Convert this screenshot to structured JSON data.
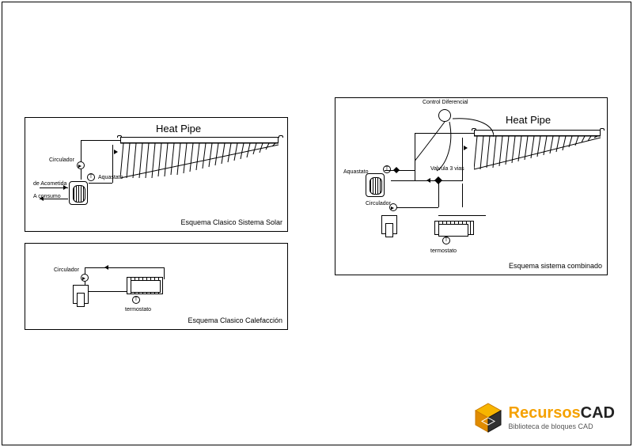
{
  "panel1": {
    "title": "Esquema Clasico Sistema Solar",
    "heatpipe": "Heat Pipe",
    "labels": {
      "circulador": "Circulador",
      "aquastato": "Aquastato",
      "deAcometida": "de Acometida",
      "aConsumo": "A consumo"
    }
  },
  "panel2": {
    "title": "Esquema Clasico Calefacción",
    "labels": {
      "circulador": "Circulador",
      "termostato": "termostato"
    }
  },
  "panel3": {
    "title": "Esquema sistema combinado",
    "heatpipe": "Heat Pipe",
    "labels": {
      "controlDiferencial": "Control Diferencial",
      "valvula3vias": "Valvula 3 vias",
      "aquastato": "Aquastato",
      "circulador": "Circulador",
      "termostato": "termostato"
    }
  },
  "sensorT": "T",
  "logo": {
    "brandYellow": "Recursos",
    "brandBlack": "CAD",
    "tagline": "Biblioteca de bloques CAD"
  }
}
